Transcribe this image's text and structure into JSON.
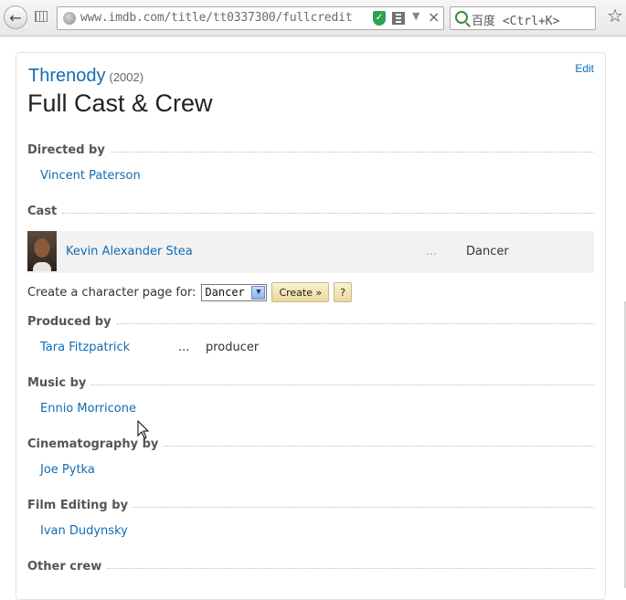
{
  "browser": {
    "url": "www.imdb.com/title/tt0337300/fullcredit",
    "search_placeholder": "百度 <Ctrl+K>"
  },
  "header": {
    "movie_title": "Threnody",
    "year": "(2002)",
    "edit_label": "Edit",
    "page_title": "Full Cast & Crew"
  },
  "sections": {
    "directed_by": {
      "heading": "Directed by",
      "people": [
        {
          "name": "Vincent Paterson"
        }
      ]
    },
    "cast": {
      "heading": "Cast",
      "members": [
        {
          "name": "Kevin Alexander Stea",
          "dots": "...",
          "character": "Dancer"
        }
      ]
    },
    "character_page": {
      "label": "Create a character page for:",
      "selected": "Dancer",
      "create_label": "Create »",
      "help_label": "?"
    },
    "produced_by": {
      "heading": "Produced by",
      "people": [
        {
          "name": "Tara Fitzpatrick",
          "dots": "...",
          "credit": "producer"
        }
      ]
    },
    "music_by": {
      "heading": "Music by",
      "people": [
        {
          "name": "Ennio Morricone"
        }
      ]
    },
    "cinematography_by": {
      "heading": "Cinematography by",
      "people": [
        {
          "name": "Joe Pytka"
        }
      ]
    },
    "film_editing_by": {
      "heading": "Film Editing by",
      "people": [
        {
          "name": "Ivan Dudynsky"
        }
      ]
    },
    "other_crew": {
      "heading": "Other crew"
    }
  }
}
